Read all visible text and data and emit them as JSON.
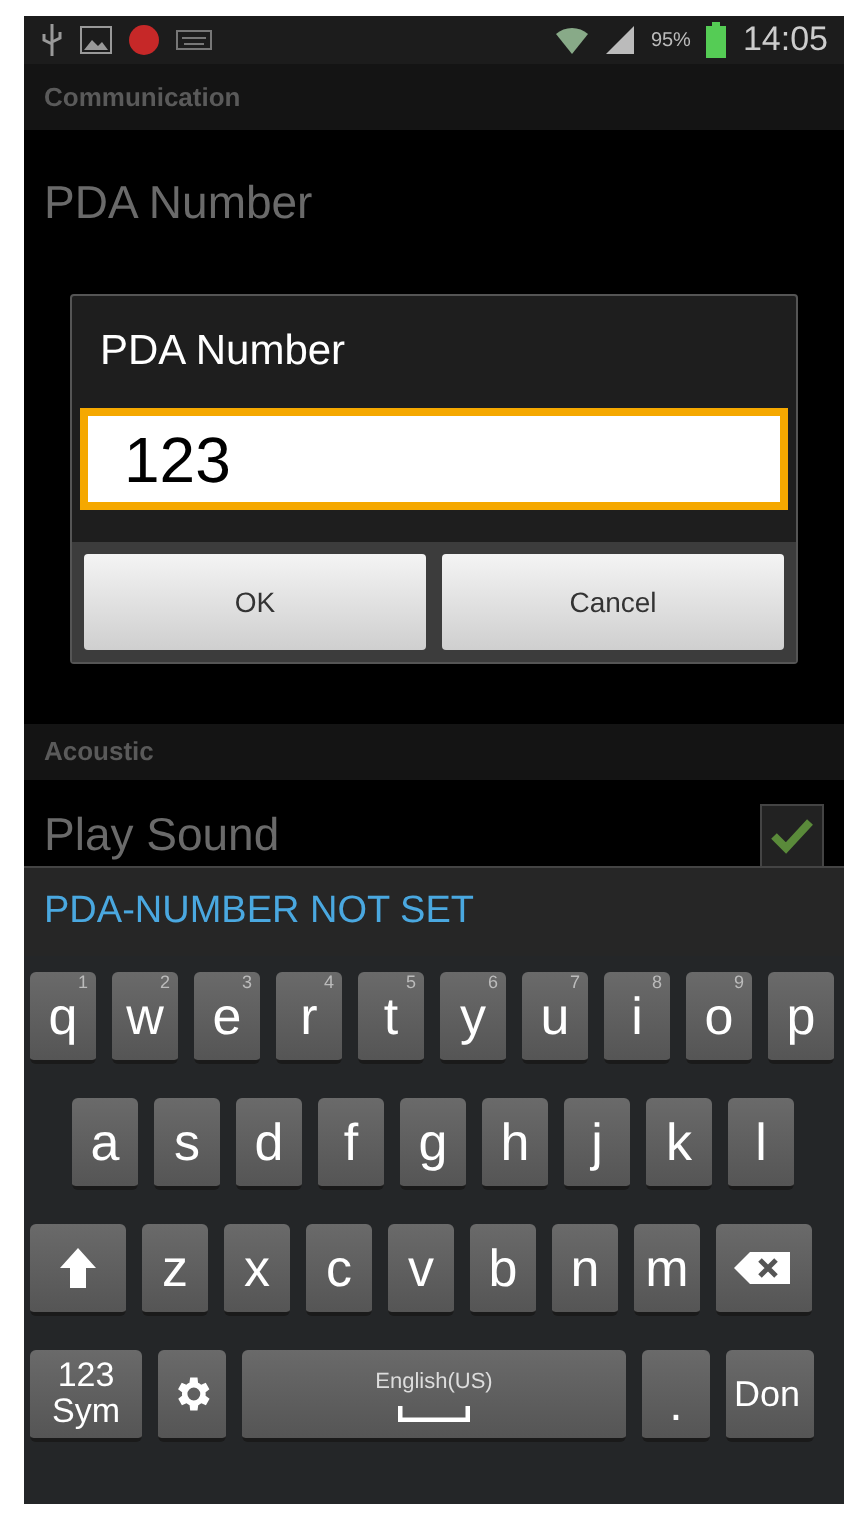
{
  "status_bar": {
    "battery_text": "95%",
    "time": "14:05"
  },
  "sections": [
    {
      "header": "Communication",
      "items": [
        {
          "title": "PDA Number"
        }
      ]
    },
    {
      "header": "Acoustic",
      "items": [
        {
          "title": "Play Sound",
          "checked": true
        }
      ]
    }
  ],
  "dialog": {
    "title": "PDA Number",
    "value": "123",
    "buttons": [
      "OK",
      "Cancel"
    ]
  },
  "toast": "PDA-NUMBER NOT SET",
  "keyboard": {
    "rows": [
      {
        "keys": [
          {
            "kind": "letter",
            "label": "q",
            "hint": "1"
          },
          {
            "kind": "letter",
            "label": "w",
            "hint": "2"
          },
          {
            "kind": "letter",
            "label": "e",
            "hint": "3"
          },
          {
            "kind": "letter",
            "label": "r",
            "hint": "4"
          },
          {
            "kind": "letter",
            "label": "t",
            "hint": "5"
          },
          {
            "kind": "letter",
            "label": "y",
            "hint": "6"
          },
          {
            "kind": "letter",
            "label": "u",
            "hint": "7"
          },
          {
            "kind": "letter",
            "label": "i",
            "hint": "8"
          },
          {
            "kind": "letter",
            "label": "o",
            "hint": "9"
          },
          {
            "kind": "letter",
            "label": "p"
          }
        ]
      },
      {
        "keys": [
          {
            "kind": "letter",
            "label": "a"
          },
          {
            "kind": "letter",
            "label": "s"
          },
          {
            "kind": "letter",
            "label": "d"
          },
          {
            "kind": "letter",
            "label": "f"
          },
          {
            "kind": "letter",
            "label": "g"
          },
          {
            "kind": "letter",
            "label": "h"
          },
          {
            "kind": "letter",
            "label": "j"
          },
          {
            "kind": "letter",
            "label": "k"
          },
          {
            "kind": "letter",
            "label": "l"
          }
        ]
      },
      {
        "keys": [
          {
            "kind": "shift"
          },
          {
            "kind": "letter",
            "label": "z"
          },
          {
            "kind": "letter",
            "label": "x"
          },
          {
            "kind": "letter",
            "label": "c"
          },
          {
            "kind": "letter",
            "label": "v"
          },
          {
            "kind": "letter",
            "label": "b"
          },
          {
            "kind": "letter",
            "label": "n"
          },
          {
            "kind": "letter",
            "label": "m"
          },
          {
            "kind": "backspace"
          }
        ]
      },
      {
        "keys": [
          {
            "kind": "symbols",
            "label": "123",
            "sub": "Sym"
          },
          {
            "kind": "settings"
          },
          {
            "kind": "space",
            "label": "English(US)"
          },
          {
            "kind": "period",
            "label": "."
          },
          {
            "kind": "action",
            "label": "Don"
          }
        ]
      }
    ]
  }
}
